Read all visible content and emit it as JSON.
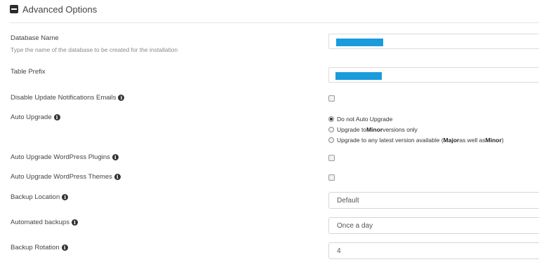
{
  "section": {
    "title": "Advanced Options"
  },
  "database_name": {
    "label": "Database Name",
    "description": "Type the name of the database to be created for the installation"
  },
  "table_prefix": {
    "label": "Table Prefix"
  },
  "disable_update_notifications": {
    "label": "Disable Update Notifications Emails"
  },
  "auto_upgrade": {
    "label": "Auto Upgrade",
    "options": [
      {
        "text": "Do not Auto Upgrade",
        "checked": true
      },
      {
        "pre": "Upgrade to ",
        "bold": "Minor",
        "post": " versions only",
        "checked": false
      },
      {
        "pre": "Upgrade to any latest version available (",
        "bold": "Major",
        "mid": " as well as ",
        "bold2": "Minor",
        "post": ")",
        "checked": false
      }
    ]
  },
  "auto_upgrade_plugins": {
    "label": "Auto Upgrade WordPress Plugins"
  },
  "auto_upgrade_themes": {
    "label": "Auto Upgrade WordPress Themes"
  },
  "backup_location": {
    "label": "Backup Location",
    "value": "Default"
  },
  "automated_backups": {
    "label": "Automated backups",
    "value": "Once a day"
  },
  "backup_rotation": {
    "label": "Backup Rotation",
    "value": "4"
  },
  "colors": {
    "redaction": "#1a9bdc",
    "info_icon": "#333333"
  }
}
